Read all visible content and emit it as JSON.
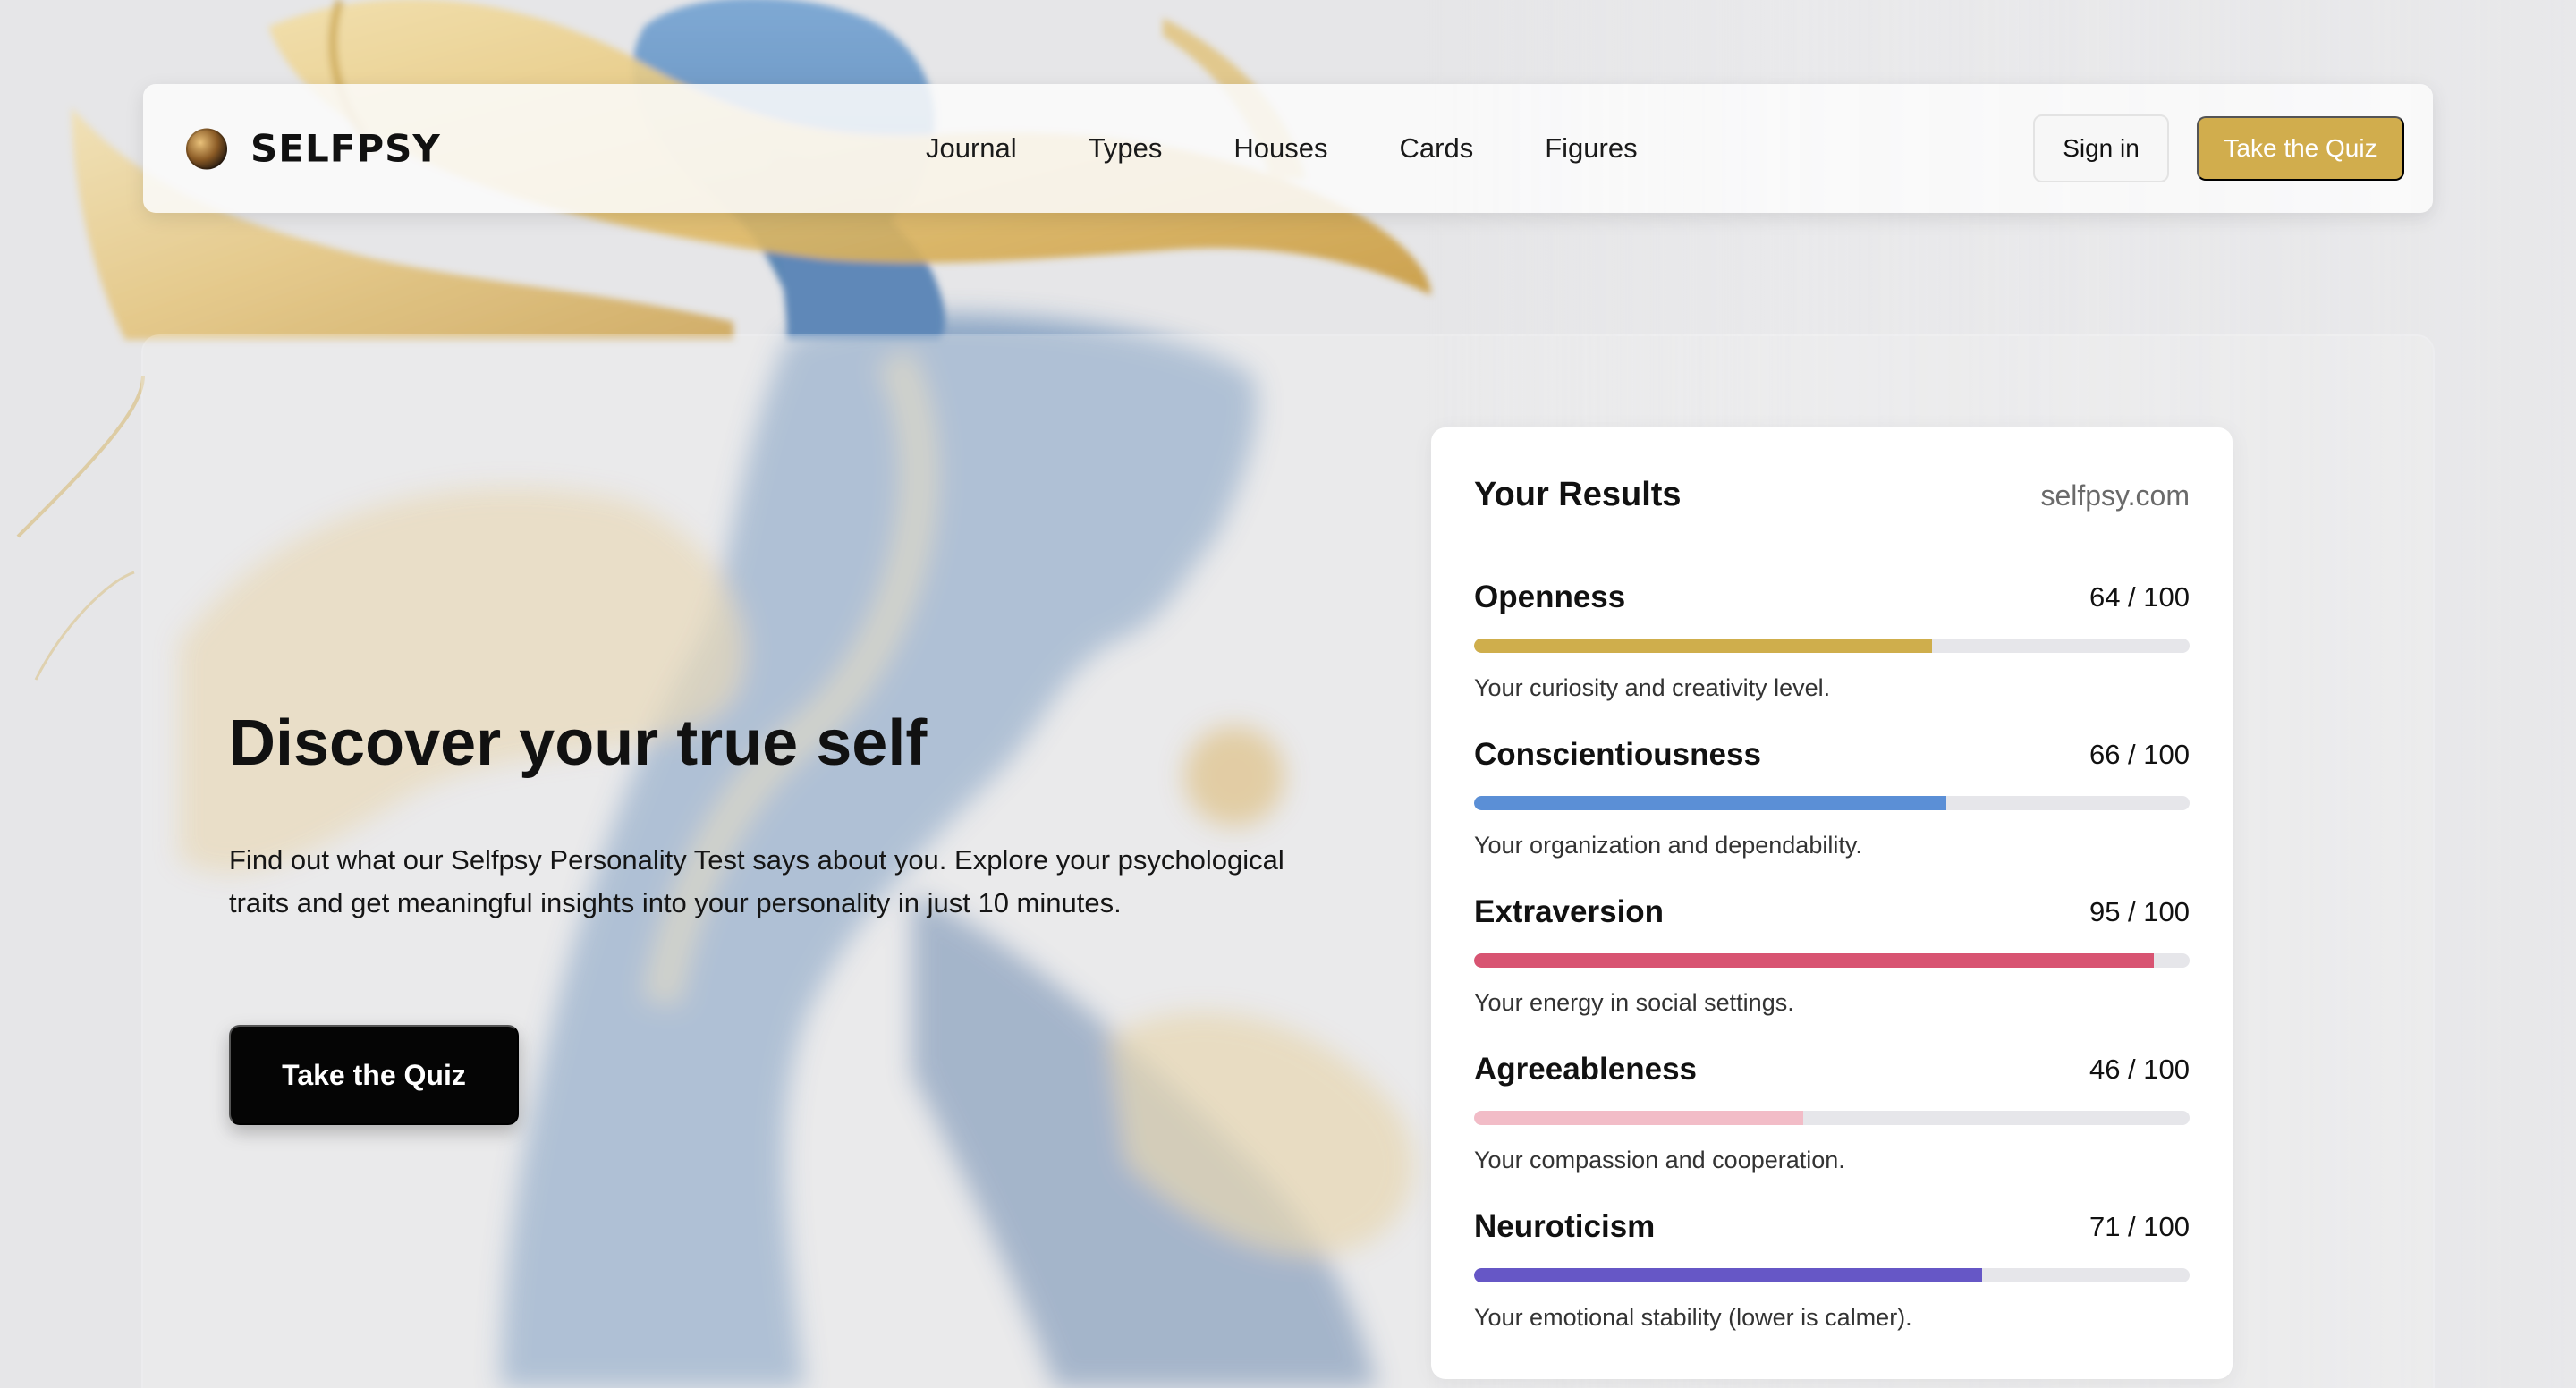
{
  "brand": {
    "name": "SELFPSY",
    "logo_icon": "brand-logo-icon"
  },
  "nav": {
    "links": [
      "Journal",
      "Types",
      "Houses",
      "Cards",
      "Figures"
    ],
    "signin_label": "Sign in",
    "quiz_label": "Take the Quiz"
  },
  "hero": {
    "title": "Discover your true self",
    "description": "Find out what our Selfpsy Personality Test says about you. Explore your psychological traits and get meaningful insights into your personality in just 10 minutes.",
    "cta_label": "Take the Quiz"
  },
  "results": {
    "title": "Your Results",
    "site": "selfpsy.com",
    "traits": [
      {
        "name": "Openness",
        "score": "64 / 100",
        "value": 64,
        "color": "#cfae4c",
        "description": "Your curiosity and creativity level."
      },
      {
        "name": "Conscientiousness",
        "score": "66 / 100",
        "value": 66,
        "color": "#5b8fd6",
        "description": "Your organization and dependability."
      },
      {
        "name": "Extraversion",
        "score": "95 / 100",
        "value": 95,
        "color": "#d85472",
        "description": "Your energy in social settings."
      },
      {
        "name": "Agreeableness",
        "score": "46 / 100",
        "value": 46,
        "color": "#f2bcc7",
        "description": "Your compassion and cooperation."
      },
      {
        "name": "Neuroticism",
        "score": "71 / 100",
        "value": 71,
        "color": "#6657c6",
        "description": "Your emotional stability (lower is calmer)."
      }
    ]
  },
  "colors": {
    "accent": "#d1ad4d",
    "background": "#e6e6e8",
    "cta_dark": "#050505"
  }
}
